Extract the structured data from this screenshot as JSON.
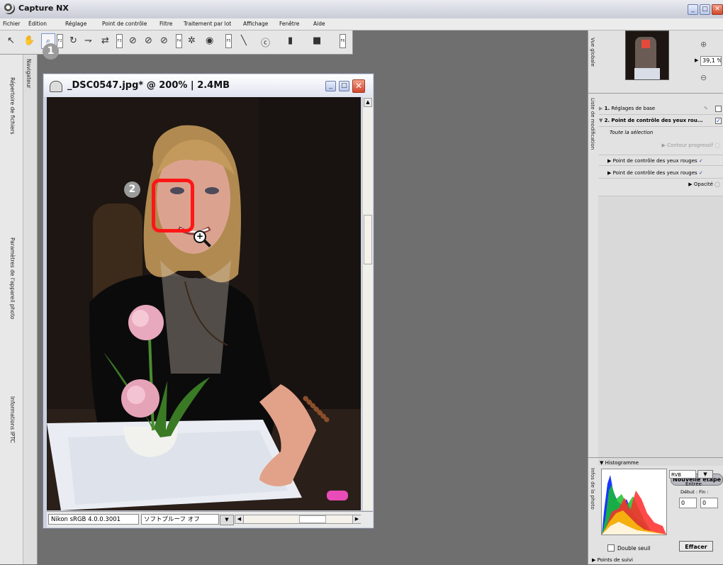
{
  "app": {
    "title": "Capture NX",
    "icon": "capture-nx-logo-icon"
  },
  "menu": [
    "Fichier",
    "Édition",
    "Réglage",
    "Point de contrôle",
    "Filtre",
    "Traitement par lot",
    "Affichage",
    "Fenêtre",
    "Aide"
  ],
  "toolbar": {
    "tools": [
      {
        "name": "arrow-tool-icon",
        "glyph": "↖"
      },
      {
        "name": "hand-tool-icon",
        "glyph": "✋"
      },
      {
        "name": "zoom-tool-icon",
        "glyph": "🔍"
      },
      {
        "name": "rotate-tool-icon",
        "glyph": "↻"
      },
      {
        "name": "straighten-tool-icon",
        "glyph": "⇁"
      },
      {
        "name": "crop-tool-icon",
        "glyph": "⇄"
      },
      {
        "name": "black-point-icon",
        "glyph": "⊘"
      },
      {
        "name": "neutral-point-icon",
        "glyph": "⊘"
      },
      {
        "name": "white-point-icon",
        "glyph": "⊘"
      },
      {
        "name": "color-control-point-icon",
        "glyph": "✲"
      },
      {
        "name": "red-eye-control-point-icon",
        "glyph": "◉"
      },
      {
        "name": "brush-icon",
        "glyph": "╲"
      },
      {
        "name": "lasso-icon",
        "glyph": "ⓒ"
      },
      {
        "name": "gradient-icon",
        "glyph": "▮"
      },
      {
        "name": "fill-icon",
        "glyph": "■"
      }
    ],
    "fkeys": [
      "F2",
      "F3",
      "F4",
      "F5",
      "F6"
    ]
  },
  "badges": {
    "one": "1",
    "two": "2"
  },
  "left_tabs": [
    "Navigateur",
    "Répertoire de fichiers",
    "Paramètres de l'appareil photo",
    "Informations IPTC"
  ],
  "document": {
    "title": "_DSC0547.jpg* @ 200% | 2.4MB",
    "color_profile": "Nikon sRGB 4.0.0.3001",
    "softproof": "ソフトプルーフ オフ"
  },
  "birdseye": {
    "label": "Vue globale",
    "zoom": "39,1",
    "zoom_unit": "%"
  },
  "edit_list": {
    "label": "Liste de modification",
    "steps": [
      {
        "number": "1.",
        "label": "Réglages de base"
      },
      {
        "number": "2.",
        "label": "Point de contrôle des yeux rou..."
      }
    ],
    "selection": "Toute la sélection",
    "items": [
      {
        "label": "Contour progressif",
        "enabled": false
      },
      {
        "label": "Point de contrôle des yeux rouges",
        "enabled": true
      },
      {
        "label": "Point de contrôle des yeux rouges",
        "enabled": true
      },
      {
        "label": "Opacité",
        "enabled": true
      }
    ],
    "new_step_button": "Nouvelle étape"
  },
  "photo_info": {
    "label": "Infos de la photo",
    "histogram_title": "Histogramme",
    "channel": "RVB",
    "input_label": "Entrée",
    "start_label": "Début :",
    "end_label": "Fin :",
    "start_value": "0",
    "end_value": "0",
    "double_threshold": "Double seuil",
    "clear_button": "Effacer",
    "tracking_points": "Points de suivi"
  }
}
